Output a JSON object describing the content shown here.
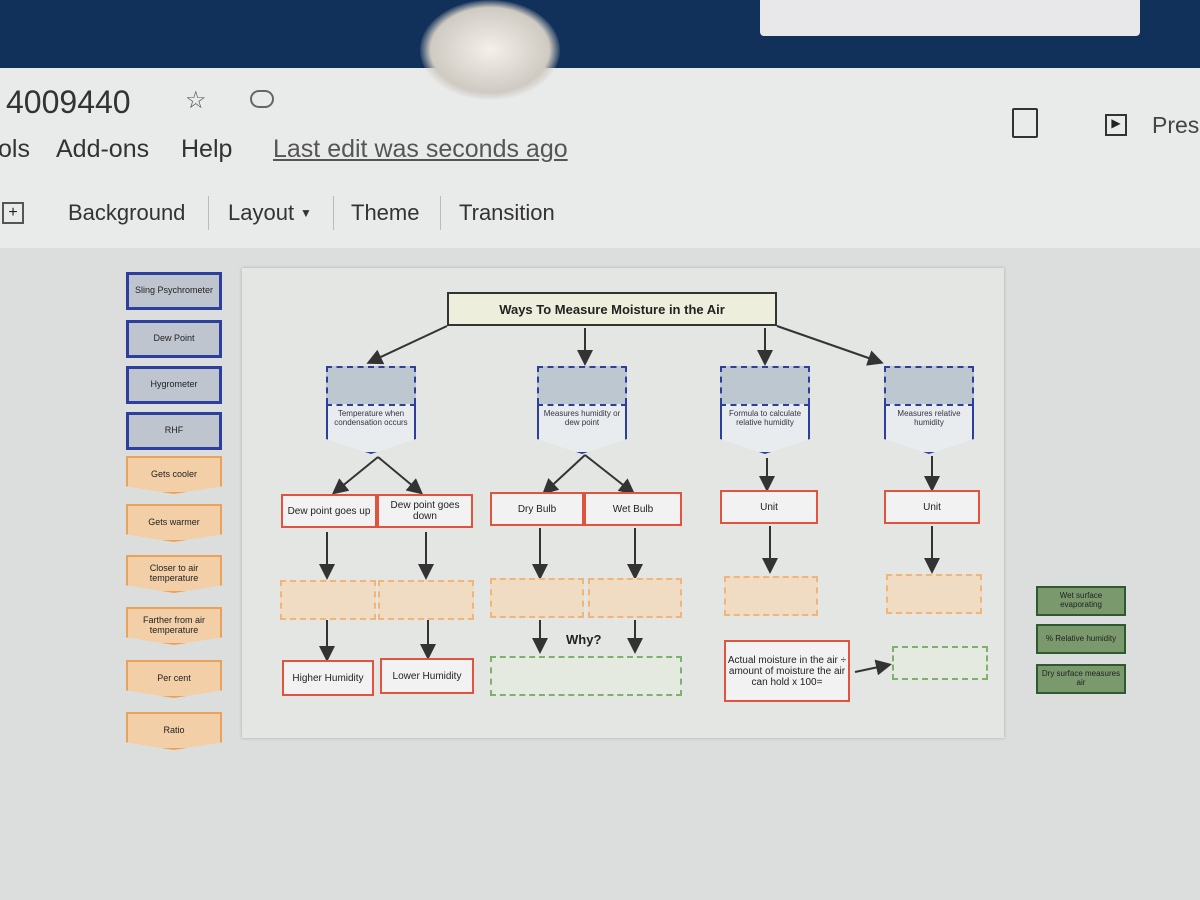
{
  "doc": {
    "title": "4009440",
    "star_icon": "star-icon",
    "cloud_icon": "cloud-saved-icon"
  },
  "menu": {
    "items": [
      "ols",
      "Add-ons",
      "Help"
    ],
    "last_edit": "Last edit was seconds ago"
  },
  "toolbar": {
    "background": "Background",
    "layout": "Layout",
    "theme": "Theme",
    "transition": "Transition"
  },
  "header_right": {
    "present": "Pres"
  },
  "left_cards": {
    "blue": [
      "Sling Psychrometer",
      "Dew Point",
      "Hygrometer",
      "RHF"
    ],
    "orange": [
      "Gets cooler",
      "Gets warmer",
      "Closer to air temperature",
      "Farther from air temperature",
      "Per cent",
      "Ratio"
    ]
  },
  "right_cards": [
    "Wet surface evaporating",
    "% Relative humidity",
    "Dry surface measures air"
  ],
  "diagram": {
    "title": "Ways To Measure Moisture in the Air",
    "descs": [
      "Temperature when condensation occurs",
      "Measures humidity or dew point",
      "Formula to calculate relative humidity",
      "Measures relative humidity"
    ],
    "boxes": [
      "Dew point goes up",
      "Dew point goes down",
      "Dry Bulb",
      "Wet Bulb",
      "Unit",
      "Unit"
    ],
    "bottom": [
      "Higher Humidity",
      "Lower Humidity"
    ],
    "why": "Why?",
    "formula": "Actual moisture in the air ÷ amount of moisture the air can hold x 100="
  },
  "colors": {
    "topbar": "#12315a",
    "blue_border": "#2d3f9c",
    "orange": "#e9a25c",
    "red": "#e0533e",
    "green": "#2f5a30"
  }
}
